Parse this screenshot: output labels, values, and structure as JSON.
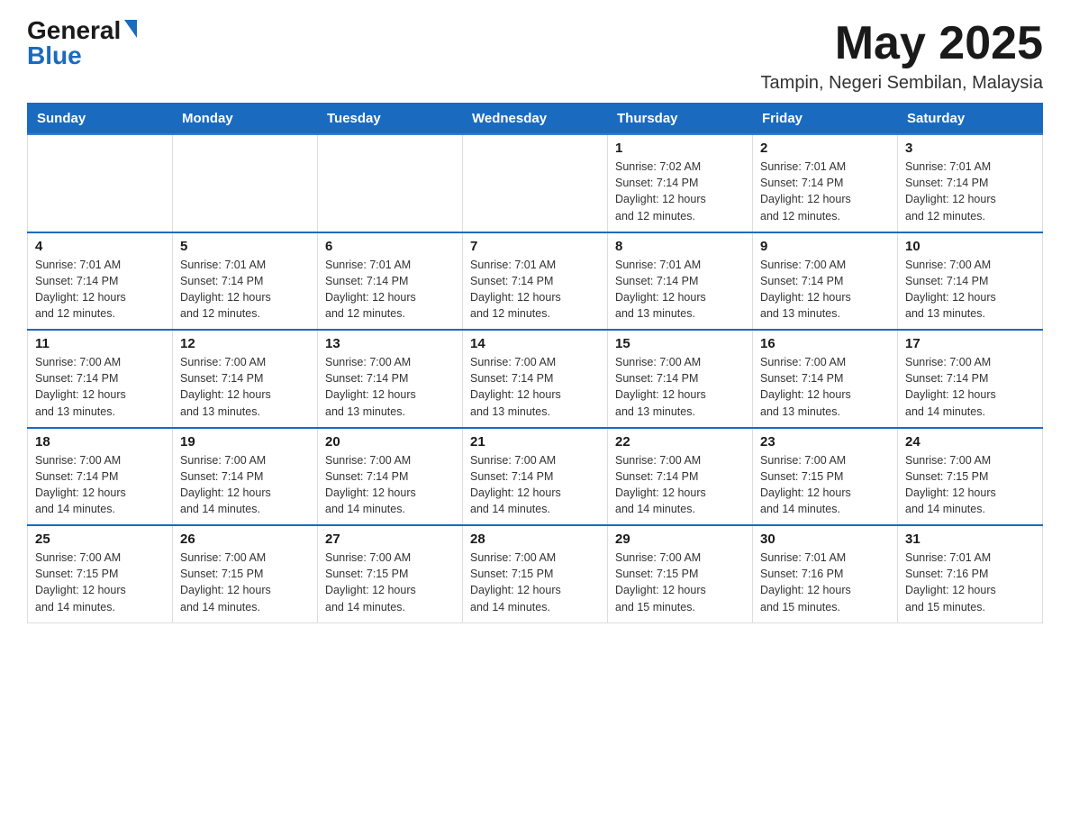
{
  "header": {
    "logo_general": "General",
    "logo_blue": "Blue",
    "month_year": "May 2025",
    "location": "Tampin, Negeri Sembilan, Malaysia"
  },
  "weekdays": [
    "Sunday",
    "Monday",
    "Tuesday",
    "Wednesday",
    "Thursday",
    "Friday",
    "Saturday"
  ],
  "weeks": [
    [
      {
        "day": "",
        "info": ""
      },
      {
        "day": "",
        "info": ""
      },
      {
        "day": "",
        "info": ""
      },
      {
        "day": "",
        "info": ""
      },
      {
        "day": "1",
        "info": "Sunrise: 7:02 AM\nSunset: 7:14 PM\nDaylight: 12 hours\nand 12 minutes."
      },
      {
        "day": "2",
        "info": "Sunrise: 7:01 AM\nSunset: 7:14 PM\nDaylight: 12 hours\nand 12 minutes."
      },
      {
        "day": "3",
        "info": "Sunrise: 7:01 AM\nSunset: 7:14 PM\nDaylight: 12 hours\nand 12 minutes."
      }
    ],
    [
      {
        "day": "4",
        "info": "Sunrise: 7:01 AM\nSunset: 7:14 PM\nDaylight: 12 hours\nand 12 minutes."
      },
      {
        "day": "5",
        "info": "Sunrise: 7:01 AM\nSunset: 7:14 PM\nDaylight: 12 hours\nand 12 minutes."
      },
      {
        "day": "6",
        "info": "Sunrise: 7:01 AM\nSunset: 7:14 PM\nDaylight: 12 hours\nand 12 minutes."
      },
      {
        "day": "7",
        "info": "Sunrise: 7:01 AM\nSunset: 7:14 PM\nDaylight: 12 hours\nand 12 minutes."
      },
      {
        "day": "8",
        "info": "Sunrise: 7:01 AM\nSunset: 7:14 PM\nDaylight: 12 hours\nand 13 minutes."
      },
      {
        "day": "9",
        "info": "Sunrise: 7:00 AM\nSunset: 7:14 PM\nDaylight: 12 hours\nand 13 minutes."
      },
      {
        "day": "10",
        "info": "Sunrise: 7:00 AM\nSunset: 7:14 PM\nDaylight: 12 hours\nand 13 minutes."
      }
    ],
    [
      {
        "day": "11",
        "info": "Sunrise: 7:00 AM\nSunset: 7:14 PM\nDaylight: 12 hours\nand 13 minutes."
      },
      {
        "day": "12",
        "info": "Sunrise: 7:00 AM\nSunset: 7:14 PM\nDaylight: 12 hours\nand 13 minutes."
      },
      {
        "day": "13",
        "info": "Sunrise: 7:00 AM\nSunset: 7:14 PM\nDaylight: 12 hours\nand 13 minutes."
      },
      {
        "day": "14",
        "info": "Sunrise: 7:00 AM\nSunset: 7:14 PM\nDaylight: 12 hours\nand 13 minutes."
      },
      {
        "day": "15",
        "info": "Sunrise: 7:00 AM\nSunset: 7:14 PM\nDaylight: 12 hours\nand 13 minutes."
      },
      {
        "day": "16",
        "info": "Sunrise: 7:00 AM\nSunset: 7:14 PM\nDaylight: 12 hours\nand 13 minutes."
      },
      {
        "day": "17",
        "info": "Sunrise: 7:00 AM\nSunset: 7:14 PM\nDaylight: 12 hours\nand 14 minutes."
      }
    ],
    [
      {
        "day": "18",
        "info": "Sunrise: 7:00 AM\nSunset: 7:14 PM\nDaylight: 12 hours\nand 14 minutes."
      },
      {
        "day": "19",
        "info": "Sunrise: 7:00 AM\nSunset: 7:14 PM\nDaylight: 12 hours\nand 14 minutes."
      },
      {
        "day": "20",
        "info": "Sunrise: 7:00 AM\nSunset: 7:14 PM\nDaylight: 12 hours\nand 14 minutes."
      },
      {
        "day": "21",
        "info": "Sunrise: 7:00 AM\nSunset: 7:14 PM\nDaylight: 12 hours\nand 14 minutes."
      },
      {
        "day": "22",
        "info": "Sunrise: 7:00 AM\nSunset: 7:14 PM\nDaylight: 12 hours\nand 14 minutes."
      },
      {
        "day": "23",
        "info": "Sunrise: 7:00 AM\nSunset: 7:15 PM\nDaylight: 12 hours\nand 14 minutes."
      },
      {
        "day": "24",
        "info": "Sunrise: 7:00 AM\nSunset: 7:15 PM\nDaylight: 12 hours\nand 14 minutes."
      }
    ],
    [
      {
        "day": "25",
        "info": "Sunrise: 7:00 AM\nSunset: 7:15 PM\nDaylight: 12 hours\nand 14 minutes."
      },
      {
        "day": "26",
        "info": "Sunrise: 7:00 AM\nSunset: 7:15 PM\nDaylight: 12 hours\nand 14 minutes."
      },
      {
        "day": "27",
        "info": "Sunrise: 7:00 AM\nSunset: 7:15 PM\nDaylight: 12 hours\nand 14 minutes."
      },
      {
        "day": "28",
        "info": "Sunrise: 7:00 AM\nSunset: 7:15 PM\nDaylight: 12 hours\nand 14 minutes."
      },
      {
        "day": "29",
        "info": "Sunrise: 7:00 AM\nSunset: 7:15 PM\nDaylight: 12 hours\nand 15 minutes."
      },
      {
        "day": "30",
        "info": "Sunrise: 7:01 AM\nSunset: 7:16 PM\nDaylight: 12 hours\nand 15 minutes."
      },
      {
        "day": "31",
        "info": "Sunrise: 7:01 AM\nSunset: 7:16 PM\nDaylight: 12 hours\nand 15 minutes."
      }
    ]
  ]
}
